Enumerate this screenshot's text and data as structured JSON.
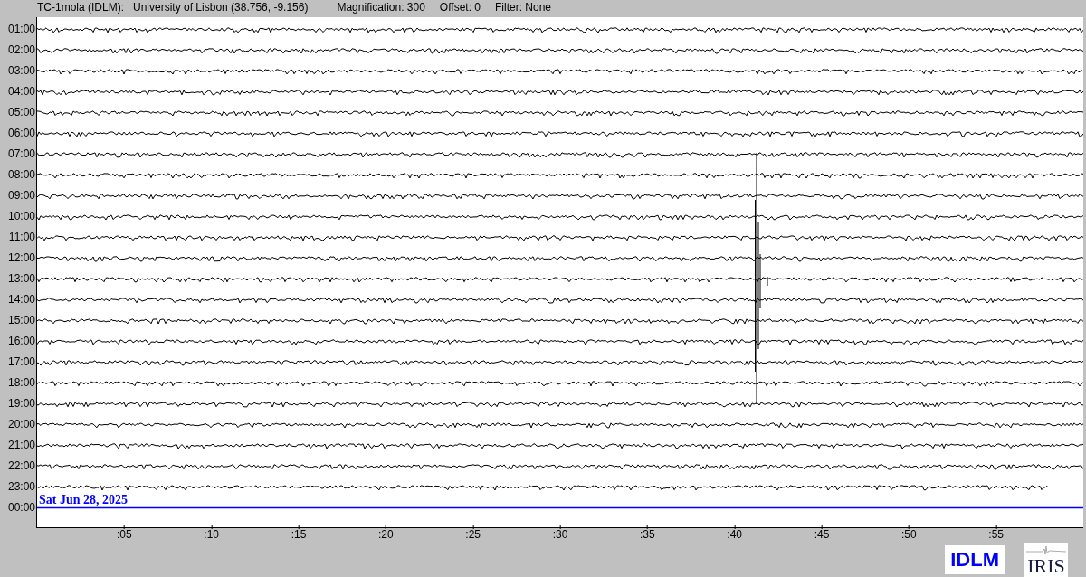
{
  "header": {
    "station": "TC-1mola (IDLM):",
    "location": "University of Lisbon (38.756, -9.156)",
    "magnification": "Magnification: 300",
    "offset": "Offset: 0",
    "filter": "Filter: None"
  },
  "rows": [
    {
      "label": "01:00",
      "kind": "trace"
    },
    {
      "label": "02:00",
      "kind": "trace"
    },
    {
      "label": "03:00",
      "kind": "trace"
    },
    {
      "label": "04:00",
      "kind": "trace"
    },
    {
      "label": "05:00",
      "kind": "trace"
    },
    {
      "label": "06:00",
      "kind": "trace"
    },
    {
      "label": "07:00",
      "kind": "trace"
    },
    {
      "label": "08:00",
      "kind": "trace"
    },
    {
      "label": "09:00",
      "kind": "trace"
    },
    {
      "label": "10:00",
      "kind": "trace"
    },
    {
      "label": "11:00",
      "kind": "trace"
    },
    {
      "label": "12:00",
      "kind": "trace"
    },
    {
      "label": "13:00",
      "kind": "trace"
    },
    {
      "label": "14:00",
      "kind": "trace"
    },
    {
      "label": "15:00",
      "kind": "trace"
    },
    {
      "label": "16:00",
      "kind": "trace"
    },
    {
      "label": "17:00",
      "kind": "trace"
    },
    {
      "label": "18:00",
      "kind": "trace"
    },
    {
      "label": "19:00",
      "kind": "trace"
    },
    {
      "label": "20:00",
      "kind": "trace"
    },
    {
      "label": "21:00",
      "kind": "trace"
    },
    {
      "label": "22:00",
      "kind": "trace"
    },
    {
      "label": "23:00",
      "kind": "partial"
    },
    {
      "label": "00:00",
      "kind": "current"
    }
  ],
  "date_label": "Sat Jun 28, 2025",
  "x_ticks": [
    ":05",
    ":10",
    ":15",
    ":20",
    ":25",
    ":30",
    ":35",
    ":40",
    ":45",
    ":50",
    ":55"
  ],
  "logos": [
    {
      "kind": "text",
      "text": "IDLM"
    },
    {
      "kind": "iris",
      "text": "IRIS"
    }
  ]
}
